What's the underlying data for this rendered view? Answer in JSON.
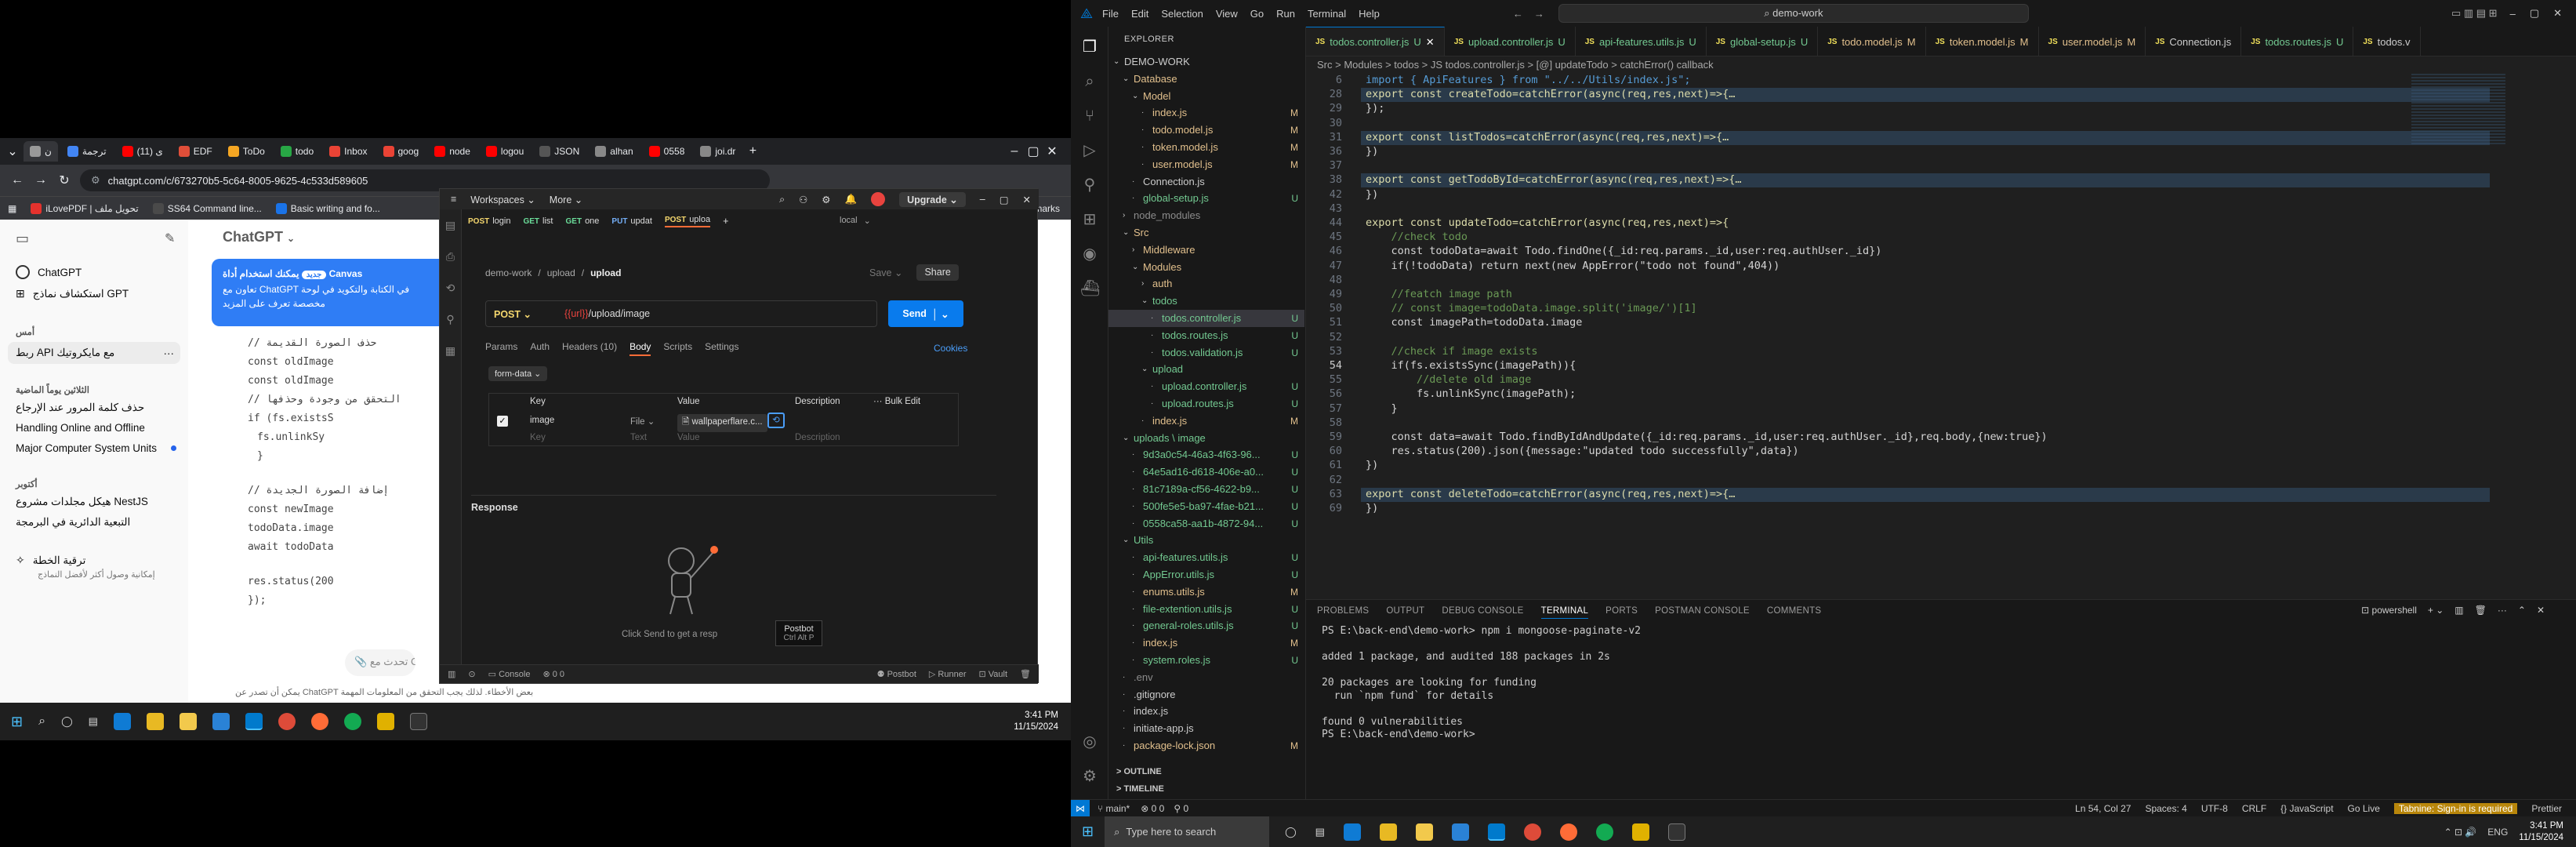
{
  "left_chrome": {
    "tabs": [
      "ن",
      "ترجمة",
      "(11) ی",
      "EDF",
      "ToDo",
      "todo",
      "Inbox",
      "goog",
      "node",
      "logou",
      "JSON",
      "alhan",
      "0558",
      "joi.dr"
    ],
    "url": "chatgpt.com/c/673270b5-5c64-8005-9625-4c533d589605",
    "bookmarks": [
      "iLovePDF | تحويل ملف",
      "SS64 Command line...",
      "Basic writing and fo...",
      "marks"
    ]
  },
  "chatgpt": {
    "model_title": "ChatGPT",
    "sidebar_items": [
      "ChatGPT",
      "استكشاف نماذج GPT"
    ],
    "section_today": "أمس",
    "today_items": [
      "ربط API مع مايكروتيك"
    ],
    "section_7days": "الثلاثين يوماً الماضية",
    "days_items": [
      "حذف كلمة المرور عند الإرجاع",
      "Handling Online and Offline",
      "Major Computer System Units"
    ],
    "section_older": "أكتوبر",
    "older_items": [
      "هيكل مجلدات مشروع NestJS",
      "التبعية الدائرية في البرمجة"
    ],
    "upgrade_label": "ترقية الخطة",
    "upgrade_sub": "إمكانية وصول أكثر لأفضل النماذج",
    "canvas_badge": "جديد",
    "canvas_title": "يمكنك استخدام أداة Canvas",
    "canvas_line1": "تعاون مع ChatGPT في الكتابة والتكويد في لوحة",
    "canvas_line2": "مخصصة تعرف على المزيد",
    "code_lines": [
      "// حذف الصورة القديمة",
      "const oldImage",
      "const oldImage",
      "// التحقق من وجودة وحذفها",
      "if (fs.existsS",
      "fs.unlinkSy",
      "}",
      "// إضافة الصورة الجديدة",
      "const newImage",
      "todoData.image",
      "await todoData",
      "res.status(200",
      "});"
    ],
    "input_placeholder": "تحدث مع ChatGPT",
    "disclaimer": "يمكن أن تصدر عن ChatGPT بعض الأخطاء. لذلك يجب التحقق من المعلومات المهمة"
  },
  "postman": {
    "top_tabs": [
      "Workspaces",
      "More"
    ],
    "upgrade": "Upgrade",
    "req_tabs": [
      {
        "method": "POST",
        "name": "login"
      },
      {
        "method": "GET",
        "name": "list"
      },
      {
        "method": "GET",
        "name": "one"
      },
      {
        "method": "PUT",
        "name": "updat"
      },
      {
        "method": "POST",
        "name": "uploa"
      }
    ],
    "environment": "local",
    "breadcrumb_a": "demo-work",
    "breadcrumb_b": "upload",
    "breadcrumb_c": "upload",
    "save": "Save",
    "share": "Share",
    "method": "POST",
    "url_var": "{{url}}",
    "url_path": "/upload/image",
    "send": "Send",
    "sub_tabs": [
      "Params",
      "Auth",
      "Headers (10)",
      "Body",
      "Scripts",
      "Settings"
    ],
    "cookies": "Cookies",
    "body_mode": "form-data",
    "col_key": "Key",
    "col_value": "Value",
    "col_desc": "Description",
    "bulk_edit": "Bulk Edit",
    "row_key": "image",
    "row_type": "File",
    "row_value": "wallpaperflare.c...",
    "empty_key": "Key",
    "empty_type": "Text",
    "empty_value": "Value",
    "empty_desc": "Description",
    "response": "Response",
    "empty_hint": "Click Send to get a resp",
    "tooltip_title": "Postbot",
    "tooltip_keys": "Ctrl  Alt  P",
    "bottom_items": [
      "Console",
      "Postbot",
      "Runner",
      "Vault"
    ],
    "counts": "0  0"
  },
  "left_taskbar": {
    "time": "3:41 PM",
    "date": "11/15/2024"
  },
  "vscode": {
    "title_search": "demo-work",
    "menu": [
      "File",
      "Edit",
      "Selection",
      "View",
      "Go",
      "Run",
      "Terminal",
      "Help"
    ],
    "explorer_title": "EXPLORER",
    "tree": [
      {
        "label": "DEMO-WORK",
        "indent": 0,
        "arrow": "v",
        "color": "#ccc",
        "badge": ""
      },
      {
        "label": "Database",
        "indent": 1,
        "arrow": "v",
        "color": "#e2c08d",
        "badge": ""
      },
      {
        "label": "Model",
        "indent": 2,
        "arrow": "v",
        "color": "#e2c08d",
        "badge": ""
      },
      {
        "label": "index.js",
        "indent": 3,
        "arrow": "",
        "color": "#e2c08d",
        "badge": "M"
      },
      {
        "label": "todo.model.js",
        "indent": 3,
        "arrow": "",
        "color": "#e2c08d",
        "badge": "M"
      },
      {
        "label": "token.model.js",
        "indent": 3,
        "arrow": "",
        "color": "#e2c08d",
        "badge": "M"
      },
      {
        "label": "user.model.js",
        "indent": 3,
        "arrow": "",
        "color": "#e2c08d",
        "badge": "M"
      },
      {
        "label": "Connection.js",
        "indent": 2,
        "arrow": "",
        "color": "#ccc",
        "badge": ""
      },
      {
        "label": "global-setup.js",
        "indent": 2,
        "arrow": "",
        "color": "#73c991",
        "badge": "U"
      },
      {
        "label": "node_modules",
        "indent": 1,
        "arrow": ">",
        "color": "#8c8c8c",
        "badge": ""
      },
      {
        "label": "Src",
        "indent": 1,
        "arrow": "v",
        "color": "#e2c08d",
        "badge": ""
      },
      {
        "label": "Middleware",
        "indent": 2,
        "arrow": ">",
        "color": "#e2c08d",
        "badge": ""
      },
      {
        "label": "Modules",
        "indent": 2,
        "arrow": "v",
        "color": "#e2c08d",
        "badge": ""
      },
      {
        "label": "auth",
        "indent": 3,
        "arrow": ">",
        "color": "#e2c08d",
        "badge": ""
      },
      {
        "label": "todos",
        "indent": 3,
        "arrow": "v",
        "color": "#73c991",
        "badge": ""
      },
      {
        "label": "todos.controller.js",
        "indent": 4,
        "arrow": "",
        "color": "#73c991",
        "badge": "U",
        "selected": true
      },
      {
        "label": "todos.routes.js",
        "indent": 4,
        "arrow": "",
        "color": "#73c991",
        "badge": "U"
      },
      {
        "label": "todos.validation.js",
        "indent": 4,
        "arrow": "",
        "color": "#73c991",
        "badge": "U"
      },
      {
        "label": "upload",
        "indent": 3,
        "arrow": "v",
        "color": "#73c991",
        "badge": ""
      },
      {
        "label": "upload.controller.js",
        "indent": 4,
        "arrow": "",
        "color": "#73c991",
        "badge": "U"
      },
      {
        "label": "upload.routes.js",
        "indent": 4,
        "arrow": "",
        "color": "#73c991",
        "badge": "U"
      },
      {
        "label": "index.js",
        "indent": 3,
        "arrow": "",
        "color": "#e2c08d",
        "badge": "M"
      },
      {
        "label": "uploads \\ image",
        "indent": 1,
        "arrow": "v",
        "color": "#73c991",
        "badge": ""
      },
      {
        "label": "9d3a0c54-46a3-4f63-96...",
        "indent": 2,
        "arrow": "",
        "color": "#73c991",
        "badge": "U"
      },
      {
        "label": "64e5ad16-d618-406e-a0...",
        "indent": 2,
        "arrow": "",
        "color": "#73c991",
        "badge": "U"
      },
      {
        "label": "81c7189a-cf56-4622-b9...",
        "indent": 2,
        "arrow": "",
        "color": "#73c991",
        "badge": "U"
      },
      {
        "label": "500fe5e5-ba97-4fae-b21...",
        "indent": 2,
        "arrow": "",
        "color": "#73c991",
        "badge": "U"
      },
      {
        "label": "0558ca58-aa1b-4872-94...",
        "indent": 2,
        "arrow": "",
        "color": "#73c991",
        "badge": "U"
      },
      {
        "label": "Utils",
        "indent": 1,
        "arrow": "v",
        "color": "#73c991",
        "badge": ""
      },
      {
        "label": "api-features.utils.js",
        "indent": 2,
        "arrow": "",
        "color": "#73c991",
        "badge": "U"
      },
      {
        "label": "AppError.utils.js",
        "indent": 2,
        "arrow": "",
        "color": "#73c991",
        "badge": "U"
      },
      {
        "label": "enums.utils.js",
        "indent": 2,
        "arrow": "",
        "color": "#e2c08d",
        "badge": "M"
      },
      {
        "label": "file-extention.utils.js",
        "indent": 2,
        "arrow": "",
        "color": "#73c991",
        "badge": "U"
      },
      {
        "label": "general-roles.utils.js",
        "indent": 2,
        "arrow": "",
        "color": "#73c991",
        "badge": "U"
      },
      {
        "label": "index.js",
        "indent": 2,
        "arrow": "",
        "color": "#e2c08d",
        "badge": "M"
      },
      {
        "label": "system.roles.js",
        "indent": 2,
        "arrow": "",
        "color": "#73c991",
        "badge": "U"
      },
      {
        "label": ".env",
        "indent": 1,
        "arrow": "",
        "color": "#8c8c8c",
        "badge": ""
      },
      {
        "label": ".gitignore",
        "indent": 1,
        "arrow": "",
        "color": "#ccc",
        "badge": ""
      },
      {
        "label": "index.js",
        "indent": 1,
        "arrow": "",
        "color": "#ccc",
        "badge": ""
      },
      {
        "label": "initiate-app.js",
        "indent": 1,
        "arrow": "",
        "color": "#ccc",
        "badge": ""
      },
      {
        "label": "package-lock.json",
        "indent": 1,
        "arrow": "",
        "color": "#e2c08d",
        "badge": "M"
      }
    ],
    "outline": "OUTLINE",
    "timeline": "TIMELINE",
    "tabs": [
      {
        "label": "todos.controller.js",
        "badge": "U",
        "active": true
      },
      {
        "label": "upload.controller.js",
        "badge": "U"
      },
      {
        "label": "api-features.utils.js",
        "badge": "U"
      },
      {
        "label": "global-setup.js",
        "badge": "U"
      },
      {
        "label": "todo.model.js",
        "badge": "M"
      },
      {
        "label": "token.model.js",
        "badge": "M"
      },
      {
        "label": "user.model.js",
        "badge": "M"
      },
      {
        "label": "Connection.js",
        "badge": ""
      },
      {
        "label": "todos.routes.js",
        "badge": "U"
      },
      {
        "label": "todos.v",
        "badge": ""
      }
    ],
    "breadcrumb": "Src > Modules > todos > JS todos.controller.js > [@] updateTodo > catchError() callback",
    "code": [
      {
        "n": "6",
        "t": "import { ApiFeatures } from \"../../Utils/index.js\";",
        "cls": "k"
      },
      {
        "n": "28",
        "t": "export const createTodo=catchError(async(req,res,next)=>{…",
        "fold": true
      },
      {
        "n": "29",
        "t": "});"
      },
      {
        "n": "30",
        "t": ""
      },
      {
        "n": "31",
        "t": "export const listTodos=catchError(async(req,res,next)=>{…",
        "fold": true
      },
      {
        "n": "36",
        "t": "})"
      },
      {
        "n": "37",
        "t": ""
      },
      {
        "n": "38",
        "t": "export const getTodoById=catchError(async(req,res,next)=>{…",
        "fold": true
      },
      {
        "n": "42",
        "t": "})"
      },
      {
        "n": "43",
        "t": ""
      },
      {
        "n": "44",
        "t": "export const updateTodo=catchError(async(req,res,next)=>{"
      },
      {
        "n": "45",
        "t": "    //check todo",
        "cls": "c"
      },
      {
        "n": "46",
        "t": "    const todoData=await Todo.findOne({_id:req.params._id,user:req.authUser._id})"
      },
      {
        "n": "47",
        "t": "    if(!todoData) return next(new AppError(\"todo not found\",404))"
      },
      {
        "n": "48",
        "t": ""
      },
      {
        "n": "49",
        "t": "    //featch image path",
        "cls": "c"
      },
      {
        "n": "50",
        "t": "    // const image=todoData.image.split('image/')[1]",
        "cls": "c"
      },
      {
        "n": "51",
        "t": "    const imagePath=todoData.image"
      },
      {
        "n": "52",
        "t": ""
      },
      {
        "n": "53",
        "t": "    //check if image exists",
        "cls": "c"
      },
      {
        "n": "54",
        "t": "    if(fs.existsSync(imagePath)){"
      },
      {
        "n": "55",
        "t": "        //delete old image",
        "cls": "c"
      },
      {
        "n": "56",
        "t": "        fs.unlinkSync(imagePath);"
      },
      {
        "n": "57",
        "t": "    }"
      },
      {
        "n": "58",
        "t": ""
      },
      {
        "n": "59",
        "t": "    const data=await Todo.findByIdAndUpdate({_id:req.params._id,user:req.authUser._id},req.body,{new:true})"
      },
      {
        "n": "60",
        "t": "    res.status(200).json({message:\"updated todo successfully\",data})"
      },
      {
        "n": "61",
        "t": "})"
      },
      {
        "n": "62",
        "t": ""
      },
      {
        "n": "63",
        "t": "export const deleteTodo=catchError(async(req,res,next)=>{…",
        "fold": true
      },
      {
        "n": "69",
        "t": "})"
      }
    ],
    "panel_tabs": [
      "PROBLEMS",
      "OUTPUT",
      "DEBUG CONSOLE",
      "TERMINAL",
      "PORTS",
      "POSTMAN CONSOLE",
      "COMMENTS"
    ],
    "shell": "powershell",
    "terminal": [
      "PS E:\\back-end\\demo-work> npm i mongoose-paginate-v2",
      "",
      "added 1 package, and audited 188 packages in 2s",
      "",
      "20 packages are looking for funding",
      "  run `npm fund` for details",
      "",
      "found 0 vulnerabilities",
      "PS E:\\back-end\\demo-work> "
    ],
    "status_left": [
      "main*",
      "0  0",
      "0"
    ],
    "status_right": [
      "Ln 54, Col 27",
      "Spaces: 4",
      "UTF-8",
      "CRLF",
      "{} JavaScript",
      "Go Live",
      "Tabnine: Sign-in is required",
      "Prettier"
    ],
    "taskbar_search": "Type here to search",
    "lang": "ENG",
    "time": "3:41 PM",
    "date": "11/15/2024"
  }
}
